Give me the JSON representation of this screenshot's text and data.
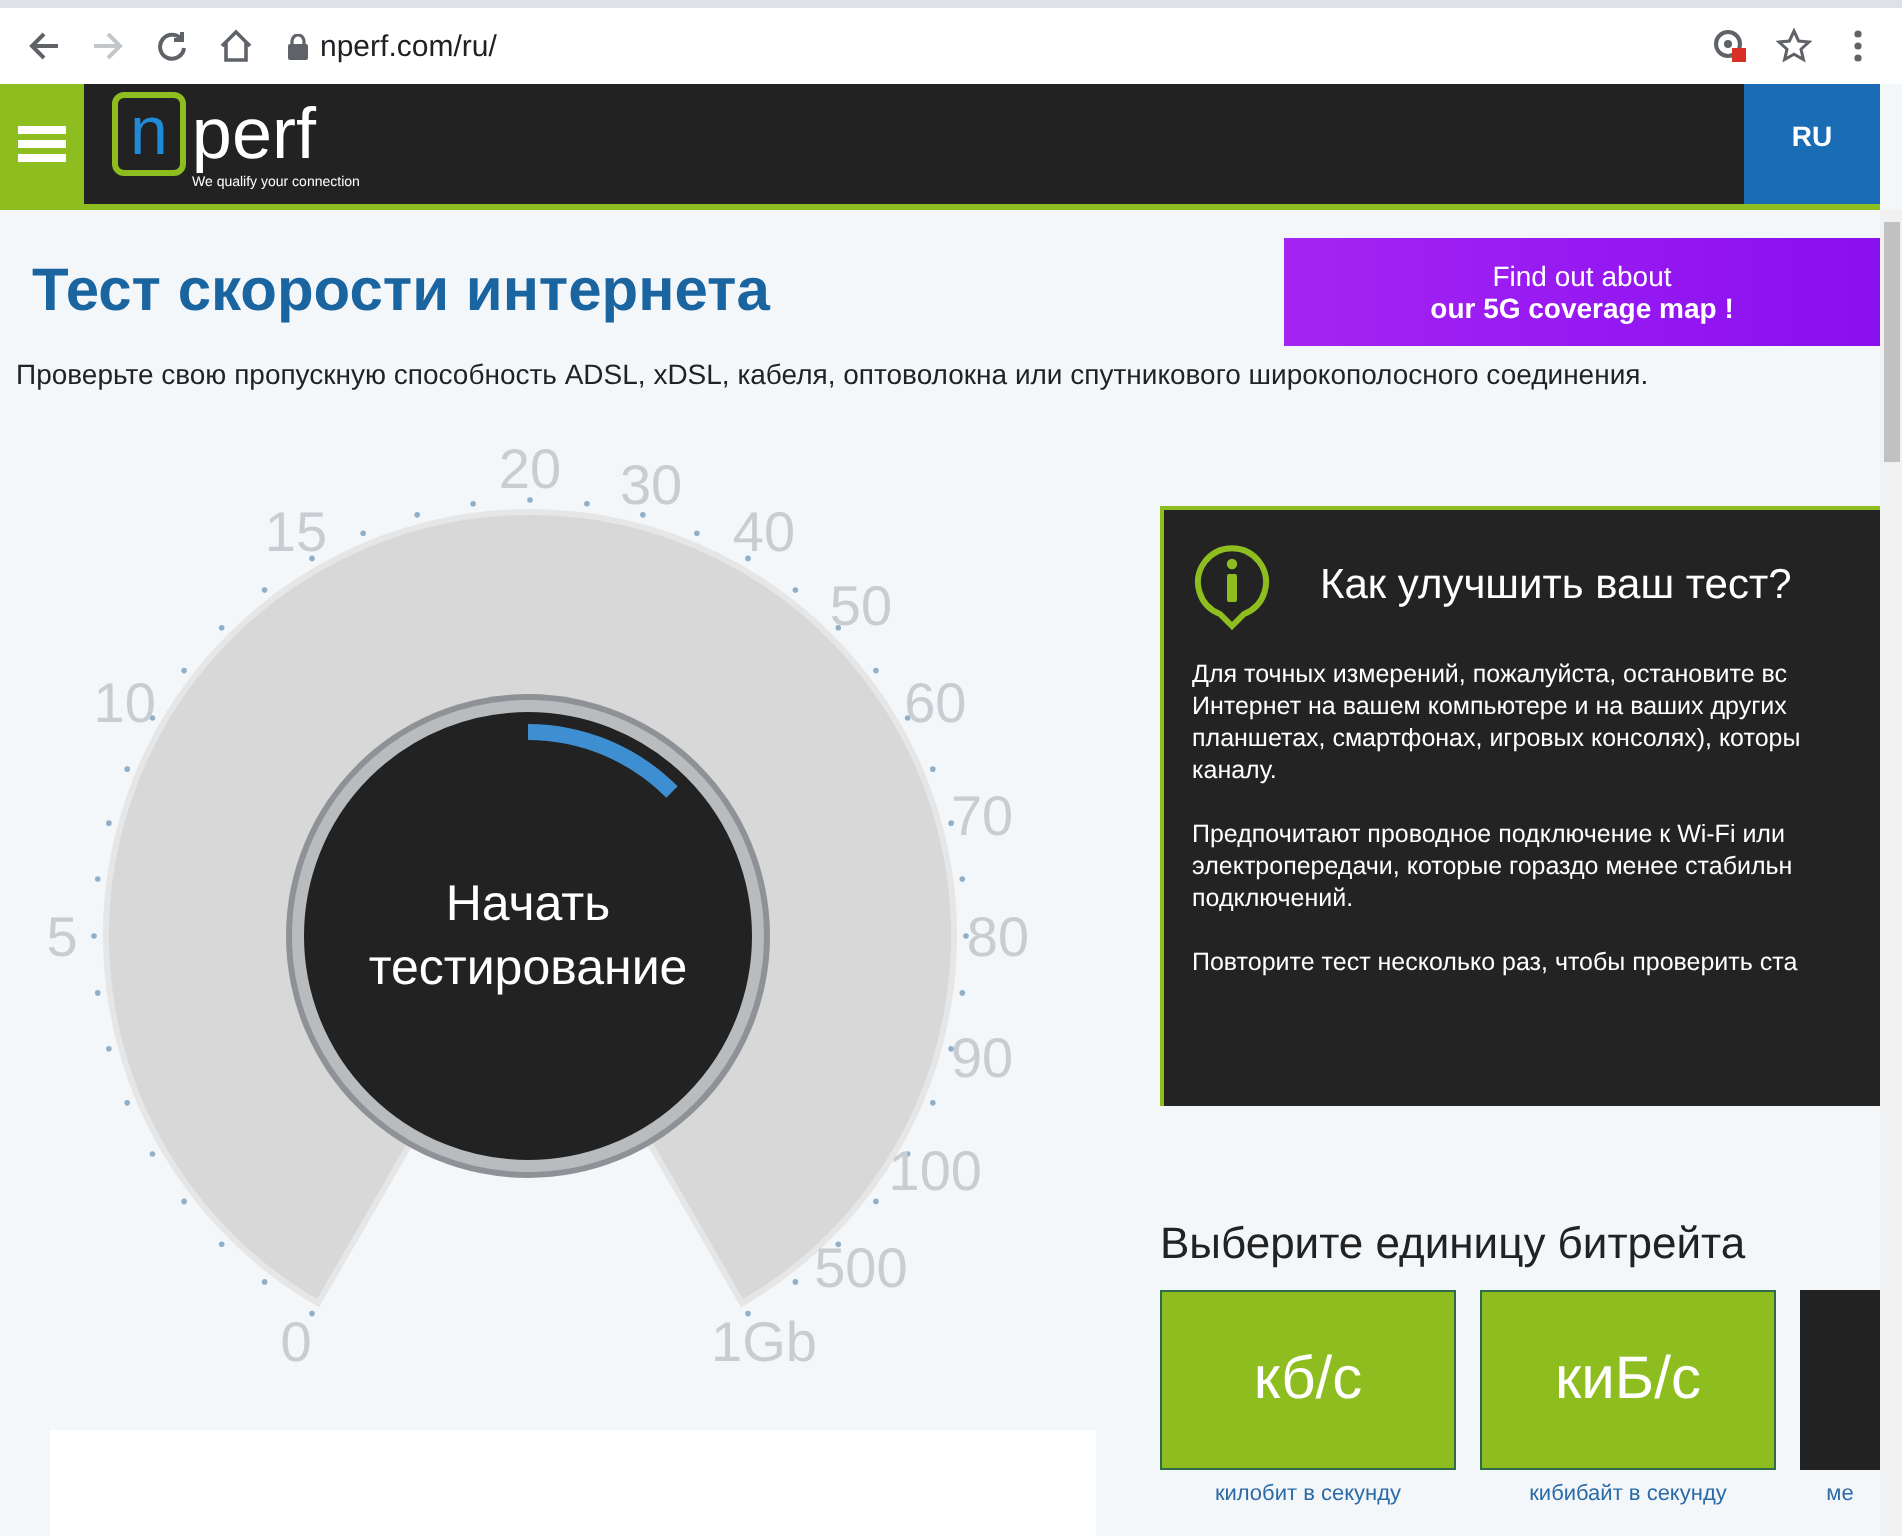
{
  "browser": {
    "url": "nperf.com/ru/"
  },
  "header": {
    "logo_mark": "n",
    "logo_text": "perf",
    "tagline": "We qualify your connection",
    "language": "RU"
  },
  "title": "Тест скорости интернета",
  "promo": {
    "line_1": "Find out about",
    "line_2": "our 5G coverage map !"
  },
  "subtitle": "Проверьте свою пропускную способность ADSL, xDSL, кабеля, оптоволокна или спутникового широкополосного соединения.",
  "gauge": {
    "scale_labels": [
      "0",
      "5",
      "10",
      "15",
      "20",
      "30",
      "40",
      "50",
      "60",
      "70",
      "80",
      "90",
      "100",
      "500",
      "1Gb"
    ],
    "start_label": "Начать тестирование"
  },
  "tips": {
    "title": "Как улучшить ваш тест?",
    "paragraphs": [
      [
        "Для точных измерений, пожалуйста, остановите вс",
        "Интернет на вашем компьютере и на ваших других",
        "планшетах, смартфонах, игровых консолях), которы",
        "каналу."
      ],
      [
        "Предпочитают проводное подключение к Wi-Fi или",
        "электропередачи, которые гораздо менее стабильн",
        "подключений."
      ],
      [
        "Повторите тест несколько раз, чтобы проверить ста"
      ]
    ]
  },
  "bitrate": {
    "title": "Выберите единицу битрейта",
    "units": [
      {
        "label": "кб/с",
        "caption": "килобит в секунду",
        "selected": false
      },
      {
        "label": "киБ/с",
        "caption": "кибибайт в секунду",
        "selected": false
      },
      {
        "caption": "ме",
        "selected": true
      }
    ]
  }
}
